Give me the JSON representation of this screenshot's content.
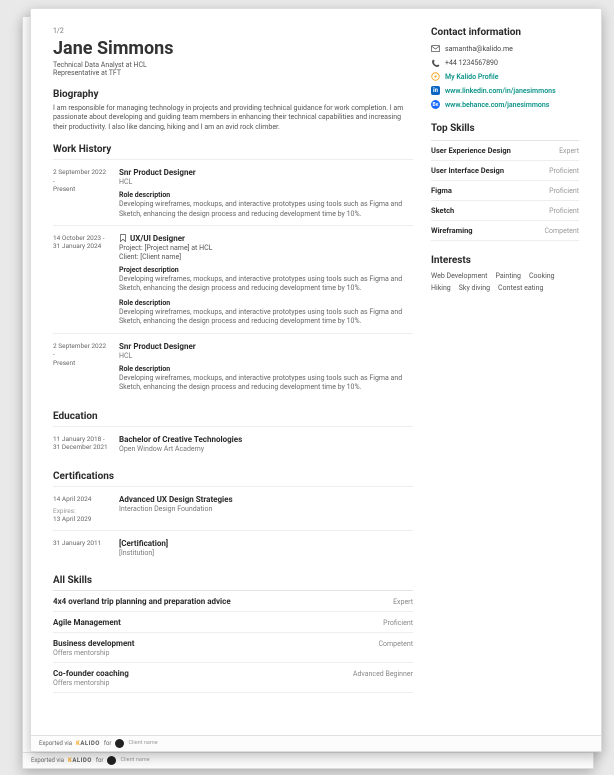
{
  "page_indicator": "1/2",
  "name": "Jane Simmons",
  "job_title": "Technical Data Analyst at HCL",
  "rep_line": "Representative at TFT",
  "biography": {
    "heading": "Biography",
    "text": "I am responsible for managing technology in projects and providing technical guidance for work completion. I am passionate about developing and guiding team members in enhancing their technical capabilities and increasing their productivity. I also like dancing, hiking and I am an avid rock climber."
  },
  "work_history": {
    "heading": "Work History",
    "items": [
      {
        "date_start": "2 September 2022 -",
        "date_end": "Present",
        "title": "Snr Product Designer",
        "org": "HCL",
        "bookmark": false,
        "blocks": [
          {
            "subheading": "Role description",
            "text": "Developing wireframes, mockups, and interactive prototypes using tools such as Figma and Sketch, enhancing the design process and reducing development time by 10%."
          }
        ]
      },
      {
        "date_start": "14 October 2023 -",
        "date_end": "31 January 2024",
        "title": "UX/UI Designer",
        "project_line": "Project: [Project name] at HCL",
        "client_line": "Client: [Client name]",
        "bookmark": true,
        "blocks": [
          {
            "subheading": "Project description",
            "text": "Developing wireframes, mockups, and interactive prototypes using tools such as Figma and Sketch, enhancing the design process and reducing development time by 10%."
          },
          {
            "subheading": "Role description",
            "text": "Developing wireframes, mockups, and interactive prototypes using tools such as Figma and Sketch, enhancing the design process and reducing development time by 10%."
          }
        ]
      },
      {
        "date_start": "2 September 2022 -",
        "date_end": "Present",
        "title": "Snr Product Designer",
        "org": "HCL",
        "bookmark": false,
        "blocks": [
          {
            "subheading": "Role description",
            "text": "Developing wireframes, mockups, and interactive prototypes using tools such as Figma and Sketch, enhancing the design process and reducing development time by 10%."
          }
        ]
      }
    ]
  },
  "education": {
    "heading": "Education",
    "items": [
      {
        "date_start": "11 January 2018 -",
        "date_end": "31 December 2021",
        "title": "Bachelor of Creative Technologies",
        "org": "Open Window Art Academy"
      }
    ]
  },
  "certifications": {
    "heading": "Certifications",
    "items": [
      {
        "date_start": "14 April 2024",
        "expires_label": "Expires:",
        "date_expires": "13 April 2029",
        "title": "Advanced UX Design Strategies",
        "org": "Interaction Design Foundation"
      },
      {
        "date_start": "31 January 2011",
        "title": "[Certification]",
        "org": "[Institution]"
      }
    ]
  },
  "all_skills": {
    "heading": "All Skills",
    "items": [
      {
        "name": "4x4 overland trip planning and preparation advice",
        "level": "Expert"
      },
      {
        "name": "Agile Management",
        "level": "Proficient"
      },
      {
        "name": "Business development",
        "sub": "Offers mentorship",
        "level": "Competent"
      },
      {
        "name": "Co-founder coaching",
        "sub": "Offers mentorship",
        "level": "Advanced Beginner"
      }
    ]
  },
  "sidebar": {
    "contact": {
      "heading": "Contact information",
      "email": "samantha@kalido.me",
      "phone": "+44 1234567890",
      "kalido_label": "My Kalido Profile",
      "linkedin": "www.linkedin.com/in/janesimmons",
      "behance": "www.behance.com/janesimmons"
    },
    "top_skills": {
      "heading": "Top Skills",
      "items": [
        {
          "name": "User Experience Design",
          "level": "Expert"
        },
        {
          "name": "User Interface Design",
          "level": "Proficient"
        },
        {
          "name": "Figma",
          "level": "Proficient"
        },
        {
          "name": "Sketch",
          "level": "Proficient"
        },
        {
          "name": "Wireframing",
          "level": "Competent"
        }
      ]
    },
    "interests": {
      "heading": "Interests",
      "items": [
        "Web Development",
        "Painting",
        "Cooking",
        "Hiking",
        "Sky diving",
        "Contest eating"
      ]
    }
  },
  "footer": {
    "exported": "Exported via",
    "brand": "KALIDO",
    "for": "for",
    "client": "Client name"
  },
  "obscured": [
    "A",
    "C",
    "C",
    "A",
    "B",
    "C",
    "C",
    "A",
    "C",
    "C",
    "A",
    "B",
    "C",
    "C",
    "C"
  ]
}
